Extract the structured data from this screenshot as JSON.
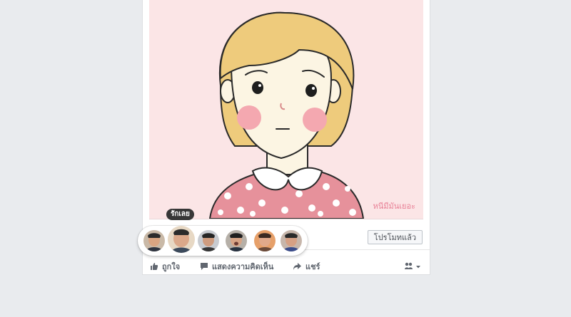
{
  "post": {
    "watermark": "หนีมีมันเยอะ",
    "promote_label": "โปรโมทแล้ว"
  },
  "reactions": {
    "tooltip": "รักเลย",
    "faces": [
      "reaction-1",
      "reaction-2",
      "reaction-3",
      "reaction-4",
      "reaction-5",
      "reaction-6"
    ]
  },
  "actions": {
    "like": "ถูกใจ",
    "comment": "แสดงความคิดเห็น",
    "share": "แชร์"
  },
  "colors": {
    "page_bg": "#e9ebee",
    "image_bg": "#fbe5e6",
    "hair": "#eecb7c",
    "shirt": "#e6919b",
    "tooltip_bg": "#373737"
  }
}
